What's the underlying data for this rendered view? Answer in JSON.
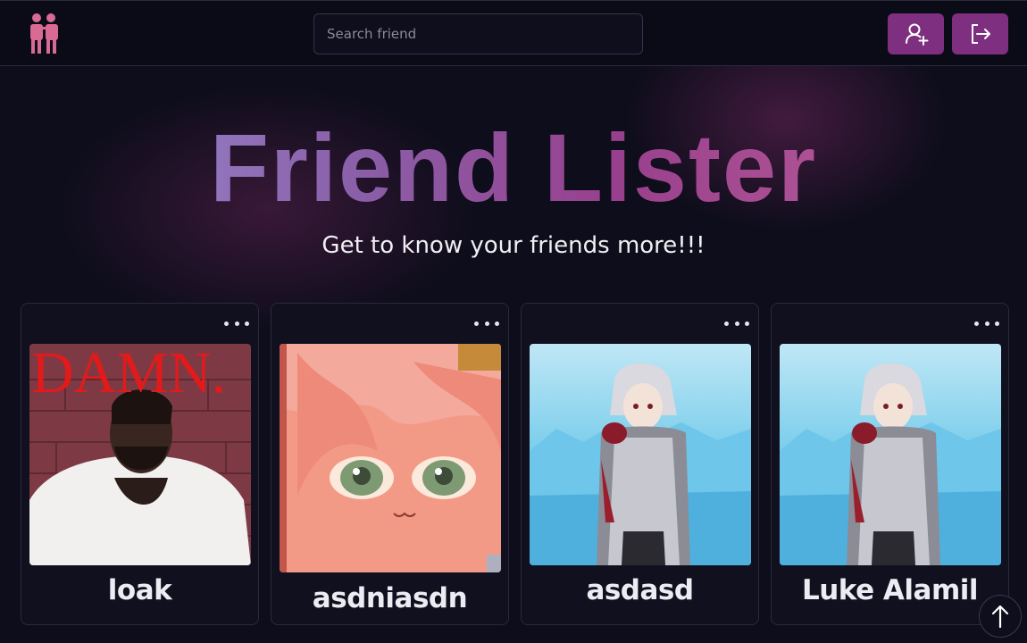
{
  "navbar": {
    "search_placeholder": "Search friend",
    "add_friend_icon": "user-plus-icon",
    "logout_icon": "logout-icon",
    "accent_color": "#7e2f7f"
  },
  "hero": {
    "title": "Friend Lister",
    "subtitle": "Get to know your friends more!!!"
  },
  "friends": [
    {
      "name": "loak",
      "photo_text": "DAMN."
    },
    {
      "name": "asdniasdn"
    },
    {
      "name": "asdasd"
    },
    {
      "name": "Luke Alamil"
    }
  ],
  "scroll_top_icon": "arrow-up-icon"
}
